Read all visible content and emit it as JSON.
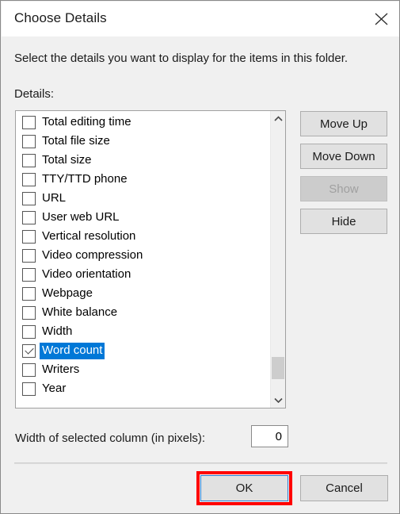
{
  "dialog": {
    "title": "Choose Details",
    "close_icon": "close-icon",
    "instruction": "Select the details you want to display for the items in this folder.",
    "details_label": "Details:"
  },
  "list": {
    "items": [
      {
        "label": "Total editing time",
        "checked": false,
        "selected": false
      },
      {
        "label": "Total file size",
        "checked": false,
        "selected": false
      },
      {
        "label": "Total size",
        "checked": false,
        "selected": false
      },
      {
        "label": "TTY/TTD phone",
        "checked": false,
        "selected": false
      },
      {
        "label": "URL",
        "checked": false,
        "selected": false
      },
      {
        "label": "User web URL",
        "checked": false,
        "selected": false
      },
      {
        "label": "Vertical resolution",
        "checked": false,
        "selected": false
      },
      {
        "label": "Video compression",
        "checked": false,
        "selected": false
      },
      {
        "label": "Video orientation",
        "checked": false,
        "selected": false
      },
      {
        "label": "Webpage",
        "checked": false,
        "selected": false
      },
      {
        "label": "White balance",
        "checked": false,
        "selected": false
      },
      {
        "label": "Width",
        "checked": false,
        "selected": false
      },
      {
        "label": "Word count",
        "checked": true,
        "selected": true
      },
      {
        "label": "Writers",
        "checked": false,
        "selected": false
      },
      {
        "label": "Year",
        "checked": false,
        "selected": false
      }
    ]
  },
  "scrollbar": {
    "up_icon": "chevron-up-icon",
    "down_icon": "chevron-down-icon"
  },
  "side_buttons": {
    "move_up": "Move Up",
    "move_down": "Move Down",
    "show": "Show",
    "hide": "Hide",
    "show_disabled": true
  },
  "width_row": {
    "label": "Width of selected column (in pixels):",
    "value": "0"
  },
  "footer": {
    "ok": "OK",
    "cancel": "Cancel"
  },
  "colors": {
    "selection_blue": "#0078d7",
    "highlight_red": "#ff0000",
    "dialog_background": "#f0f0f0",
    "button_face": "#e1e1e1"
  }
}
